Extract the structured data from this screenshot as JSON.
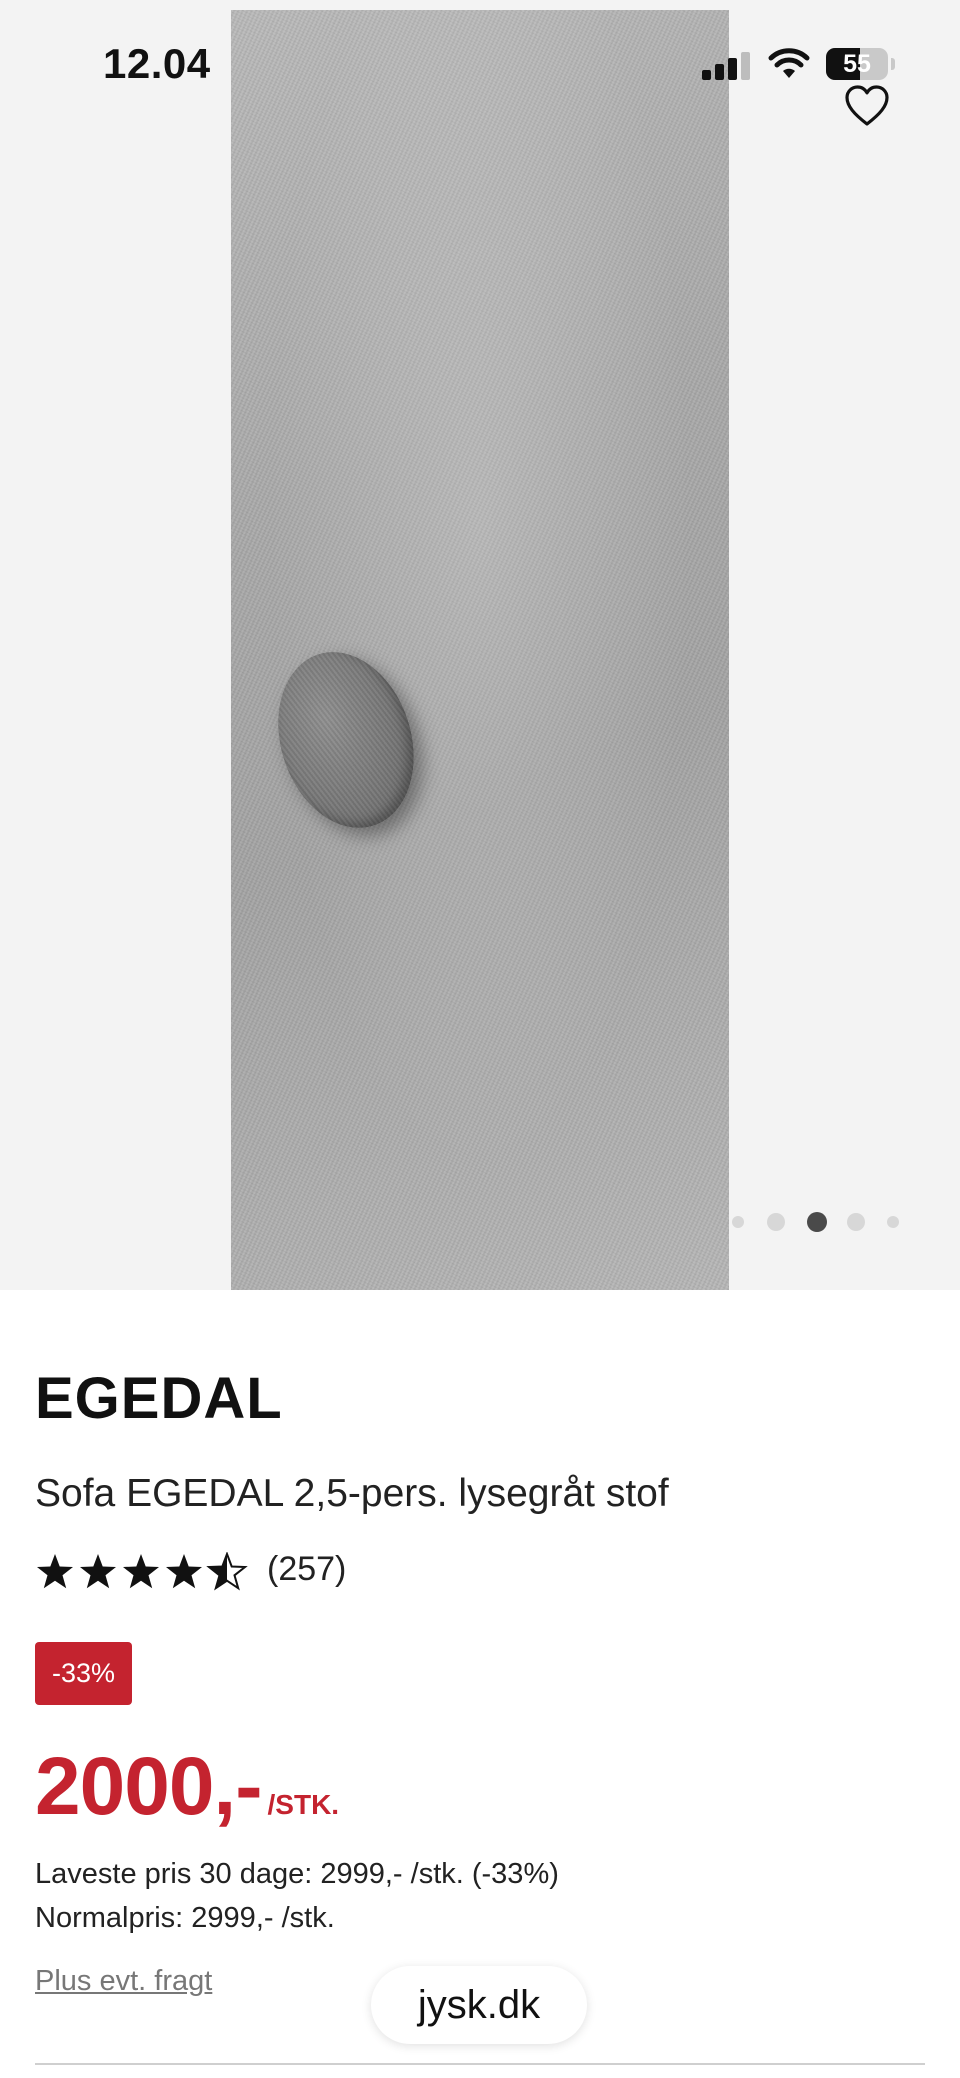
{
  "status_bar": {
    "time": "12.04",
    "battery": "55"
  },
  "gallery": {
    "dot_count": 5,
    "active_dot": 3
  },
  "product": {
    "brand": "EGEDAL",
    "name": "Sofa EGEDAL 2,5-pers. lysegråt stof",
    "rating": 4.5,
    "review_count": "(257)",
    "discount_badge": "-33%",
    "price": "2000,-",
    "price_unit": "/STK.",
    "lowest_price_30_days": "Laveste pris 30 dage: 2999,- /stk. (-33%)",
    "normal_price": "Normalpris: 2999,- /stk.",
    "freight_link": "Plus evt. fragt"
  },
  "browser": {
    "url": "jysk.dk"
  },
  "colors": {
    "accent": "#c4232f",
    "text": "#111111",
    "gallery_bg": "#f3f3f3"
  },
  "icons": [
    "signal-icon",
    "wifi-icon",
    "battery-icon",
    "heart-icon",
    "star-icon"
  ]
}
